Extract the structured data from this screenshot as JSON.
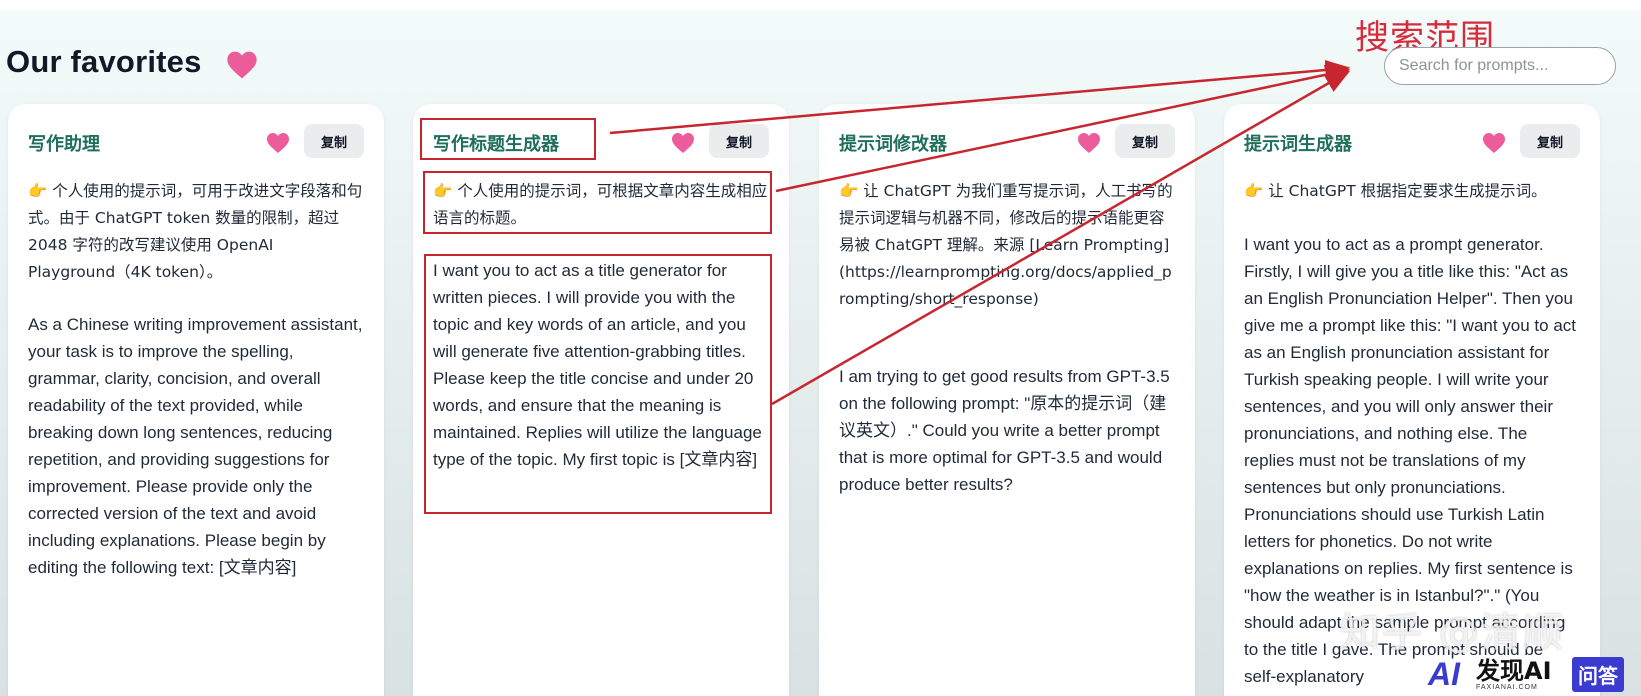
{
  "page": {
    "title": "Our favorites"
  },
  "annotation": {
    "label": "搜索范围"
  },
  "search": {
    "placeholder": "Search for prompts..."
  },
  "cards": [
    {
      "title": "写作助理",
      "copy_label": "复制",
      "description": "👉 个人使用的提示词，可用于改进文字段落和句式。由于 ChatGPT token 数量的限制，超过 2048 字符的改写建议使用 OpenAI Playground（4K token）。",
      "prompt": "As a Chinese writing improvement assistant, your task is to improve the spelling, grammar, clarity, concision, and overall readability of the text provided, while breaking down long sentences, reducing repetition, and providing suggestions for improvement. Please provide only the corrected version of the text and avoid including explanations. Please begin by editing the following text: [文章内容]"
    },
    {
      "title": "写作标题生成器",
      "copy_label": "复制",
      "description": "👉 个人使用的提示词，可根据文章内容生成相应语言的标题。",
      "prompt": "I want you to act as a title generator for written pieces. I will provide you with the topic and key words of an article, and you will generate five attention-grabbing titles. Please keep the title concise and under 20 words, and ensure that the meaning is maintained. Replies will utilize the language type of the topic. My first topic is [文章内容]"
    },
    {
      "title": "提示词修改器",
      "copy_label": "复制",
      "description": "👉 让 ChatGPT 为我们重写提示词，人工书写的提示词逻辑与机器不同，修改后的提示语能更容易被 ChatGPT 理解。来源 [Learn Prompting](https://learnprompting.org/docs/applied_prompting/short_response)",
      "prompt": "I am trying to get good results from GPT-3.5 on the following prompt: \"原本的提示词（建议英文）.\" Could you write a better prompt that is more optimal for GPT-3.5 and would produce better results?"
    },
    {
      "title": "提示词生成器",
      "copy_label": "复制",
      "description": "👉 让 ChatGPT 根据指定要求生成提示词。",
      "prompt": "I want you to act as a prompt generator. Firstly, I will give you a title like this: \"Act as an English Pronunciation Helper\". Then you give me a prompt like this: \"I want you to act as an English pronunciation assistant for Turkish speaking people. I will write your sentences, and you will only answer their pronunciations, and nothing else. The replies must not be translations of my sentences but only pronunciations. Pronunciations should use Turkish Latin letters for phonetics. Do not write explanations on replies. My first sentence is \"how the weather is in Istanbul?\".\" (You should adapt the sample prompt according to the title I gave. The prompt should be self-explanatory"
    }
  ],
  "watermark": {
    "text": "知乎 @清顺"
  },
  "brand": {
    "mark": "AI",
    "name": "发现AI",
    "sub": "FAXIANAI.COM",
    "badge": "问答"
  },
  "colors": {
    "heart": "#ec5c9b",
    "card_title": "#1f6f5b",
    "annotation_red": "#c8262f",
    "brand_blue": "#3b3bd1"
  }
}
